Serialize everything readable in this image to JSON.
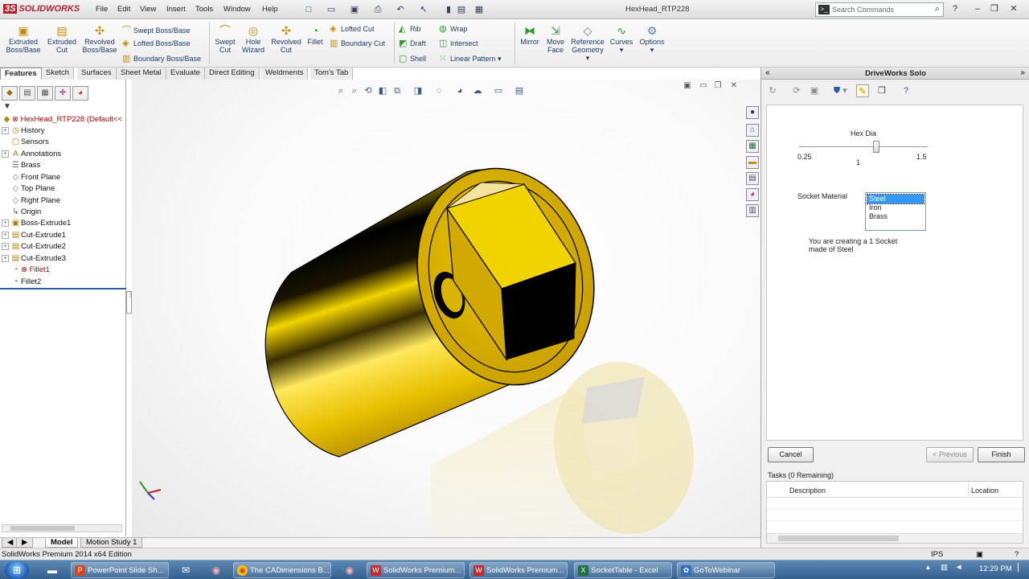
{
  "app": {
    "brand": "SOLIDWORKS",
    "menu": [
      "File",
      "Edit",
      "View",
      "Insert",
      "Tools",
      "Window",
      "Help"
    ],
    "document_title": "HexHead_RTP228",
    "search_placeholder": "Search Commands"
  },
  "ribbon": {
    "extruded_boss": "Extruded Boss/Base",
    "extruded_cut": "Extruded Cut",
    "revolved_boss": "Revolved Boss/Base",
    "swept_boss": "Swept Boss/Base",
    "lofted_boss": "Lofted Boss/Base",
    "boundary_boss": "Boundary Boss/Base",
    "swept_cut": "Swept Cut",
    "hole_wizard": "Hole Wizard",
    "revolved_cut": "Revolved Cut",
    "fillet": "Fillet",
    "lofted_cut": "Lofted Cut",
    "boundary_cut": "Boundary Cut",
    "rib": "Rib",
    "draft": "Draft",
    "shell": "Shell",
    "wrap": "Wrap",
    "intersect": "Intersect",
    "linear_pattern": "Linear Pattern",
    "mirror": "Mirror",
    "move_face": "Move Face",
    "reference_geometry": "Reference Geometry",
    "curves": "Curves",
    "options": "Options"
  },
  "command_tabs": [
    "Features",
    "Sketch",
    "Surfaces",
    "Sheet Metal",
    "Evaluate",
    "Direct Editing",
    "Weldments",
    "Tom's Tab"
  ],
  "feature_tree": {
    "root": "HexHead_RTP228  (Default<<",
    "items": [
      "History",
      "Sensors",
      "Annotations",
      "Brass",
      "Front Plane",
      "Top Plane",
      "Right Plane",
      "Origin",
      "Boss-Extrude1",
      "Cut-Extrude1",
      "Cut-Extrude2",
      "Cut-Extrude3",
      "Fillet1",
      "Fillet2"
    ]
  },
  "bottom_tabs": [
    "Model",
    "Motion Study 1"
  ],
  "status": {
    "left": "SolidWorks Premium 2014 x64 Edition",
    "units": "IPS"
  },
  "driveworks": {
    "title": "DriveWorks Solo",
    "hex_label": "Hex Dia",
    "hex_min": "0.25",
    "hex_max": "1.5",
    "hex_value": "1",
    "hex_min_num": 0.25,
    "hex_max_num": 1.5,
    "hex_value_num": 1,
    "material_label": "Socket Material",
    "materials": [
      "Steel",
      "Iron",
      "Brass"
    ],
    "selected_material": "Steel",
    "summary": "You are creating a 1 Socket made of Steel",
    "cancel": "Cancel",
    "previous": "< Previous",
    "finish": "Finish",
    "tasks_title": "Tasks (0 Remaining)",
    "col_description": "Description",
    "col_location": "Location"
  },
  "taskbar": {
    "items": [
      "PowerPoint Slide Sh...",
      "The CADimensions B...",
      "SolidWorks Premium...",
      "SolidWorks Premium...",
      "SocketTable - Excel",
      "GoToWebinar"
    ],
    "time": "12:29 PM"
  },
  "colors": {
    "part_gold": "#e8c400",
    "brand_red": "#b1232a",
    "selection_blue": "#3399ff",
    "taskbar": "#3f6c9c"
  }
}
